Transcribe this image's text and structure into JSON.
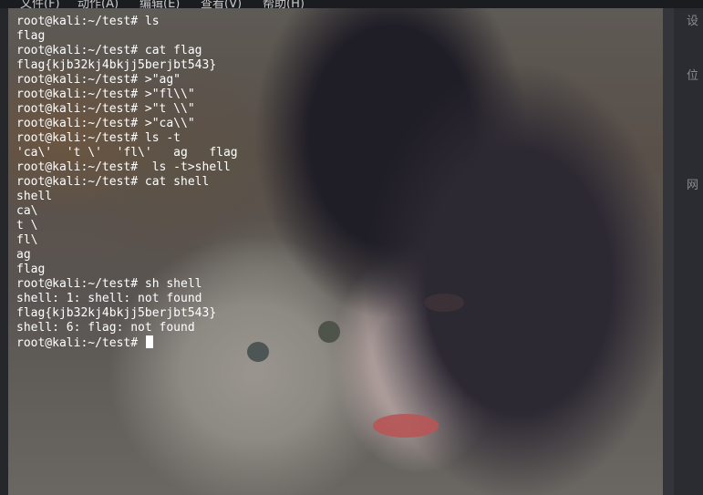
{
  "menubar": {
    "items": [
      "文件(F)",
      "动作(A)",
      "编辑(E)",
      "查看(V)",
      "帮助(H)"
    ]
  },
  "terminal": {
    "lines": [
      "root@kali:~/test# ls",
      "flag",
      "root@kali:~/test# cat flag",
      "flag{kjb32kj4bkjj5berjbt543}",
      "root@kali:~/test# >\"ag\"",
      "root@kali:~/test# >\"fl\\\\\"",
      "root@kali:~/test# >\"t \\\\\"",
      "root@kali:~/test# >\"ca\\\\\"",
      "root@kali:~/test# ls -t",
      "'ca\\'  't \\'  'fl\\'   ag   flag",
      "root@kali:~/test#  ls -t>shell",
      "root@kali:~/test# cat shell",
      "shell",
      "ca\\",
      "t \\",
      "fl\\",
      "ag",
      "flag",
      "root@kali:~/test# sh shell",
      "shell: 1: shell: not found",
      "flag{kjb32kj4bkjj5berjbt543}",
      "shell: 6: flag: not found"
    ],
    "prompt": "root@kali:~/test# "
  },
  "side_panel": {
    "labels": [
      "设",
      "位",
      "网"
    ]
  },
  "colors": {
    "text": "#ffffff",
    "background_tint": "#5e5a55",
    "panel": "#2b2c31"
  }
}
